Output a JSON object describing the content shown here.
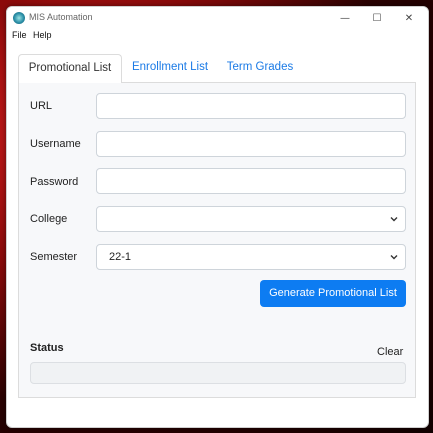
{
  "window": {
    "title": "MIS Automation",
    "minimize": "—",
    "maximize": "☐",
    "close": "✕"
  },
  "menu": {
    "file": "File",
    "help": "Help"
  },
  "tabs": [
    "Promotional List",
    "Enrollment List",
    "Term Grades"
  ],
  "form": {
    "url_label": "URL",
    "url_value": "",
    "username_label": "Username",
    "username_value": "",
    "password_label": "Password",
    "password_value": "",
    "college_label": "College",
    "college_value": "",
    "semester_label": "Semester",
    "semester_value": "22-1"
  },
  "actions": {
    "generate": "Generate Promotional List",
    "clear": "Clear"
  },
  "status": {
    "label": "Status",
    "text": ""
  },
  "colors": {
    "accent": "#0d7cf2",
    "tab_link": "#1a7ae6"
  }
}
